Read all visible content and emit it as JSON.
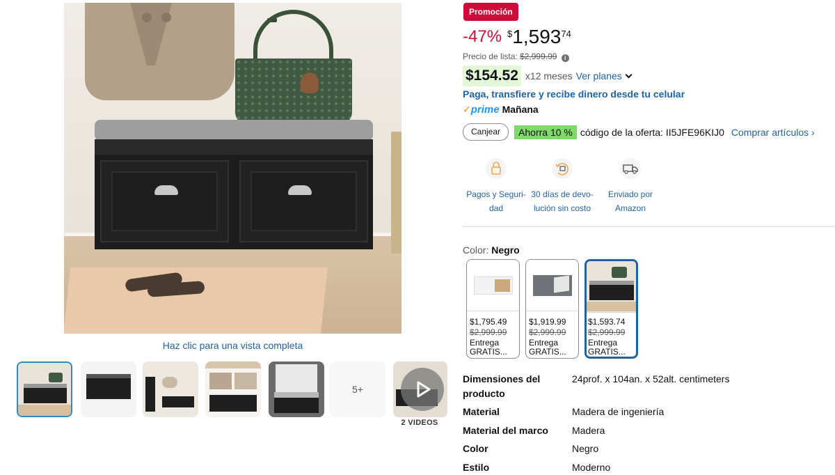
{
  "gallery": {
    "full_view_link": "Haz clic para una vista completa",
    "thumbnails": [
      "thumb-1",
      "thumb-2",
      "thumb-3",
      "thumb-4",
      "thumb-5"
    ],
    "more_label": "5+",
    "videos_label": "2 VIDEOS"
  },
  "promo_badge": "Promoción",
  "price": {
    "discount": "-47%",
    "symbol": "$",
    "whole": "1,593",
    "fraction": "74",
    "list_label": "Precio de lista:",
    "list_value": "$2,999.99",
    "info_glyph": "i"
  },
  "installments": {
    "amount": "$154.52",
    "term": "x12 meses",
    "link": "Ver planes"
  },
  "payment_promo": "Paga, transfiere y recibe dinero desde tu celular",
  "prime": {
    "check": "✓",
    "word": "prime",
    "delivery": "Mañana"
  },
  "coupon": {
    "button": "Canjear",
    "badge": "Ahorra 10 %",
    "code_text": "código de la oferta: II5JFE96KIJ0",
    "link": "Comprar artículos ›"
  },
  "features": [
    {
      "icon": "lock-payment-icon",
      "line1": "Pagos y Seguri-",
      "line2": "dad"
    },
    {
      "icon": "return-box-icon",
      "line1": "30 días de devo-",
      "line2": "lución sin costo"
    },
    {
      "icon": "delivery-truck-icon",
      "line1": "Enviado por",
      "line2": "Amazon"
    }
  ],
  "color": {
    "label": "Color:",
    "selected": "Negro",
    "options": [
      {
        "price": "$1,795.49",
        "list": "$2,999.99",
        "ship": "Entrega GRATIS..."
      },
      {
        "price": "$1,919.99",
        "list": "$2,999.99",
        "ship": "Entrega GRATIS..."
      },
      {
        "price": "$1,593.74",
        "list": "$2,999.99",
        "ship": "Entrega GRATIS..."
      }
    ]
  },
  "specs": [
    {
      "key": "Dimensiones del producto",
      "value": "24prof. x 104an. x 52alt. centimeters"
    },
    {
      "key": "Material",
      "value": "Madera de ingeniería"
    },
    {
      "key": "Material del marco",
      "value": "Madera"
    },
    {
      "key": "Color",
      "value": "Negro"
    },
    {
      "key": "Estilo",
      "value": "Moderno"
    }
  ],
  "colors": {
    "link": "#2162a1",
    "deal_red": "#cc0c39",
    "prime_blue": "#1a98ff",
    "savings_green": "#7fda69",
    "selected_border": "#2162a1"
  }
}
